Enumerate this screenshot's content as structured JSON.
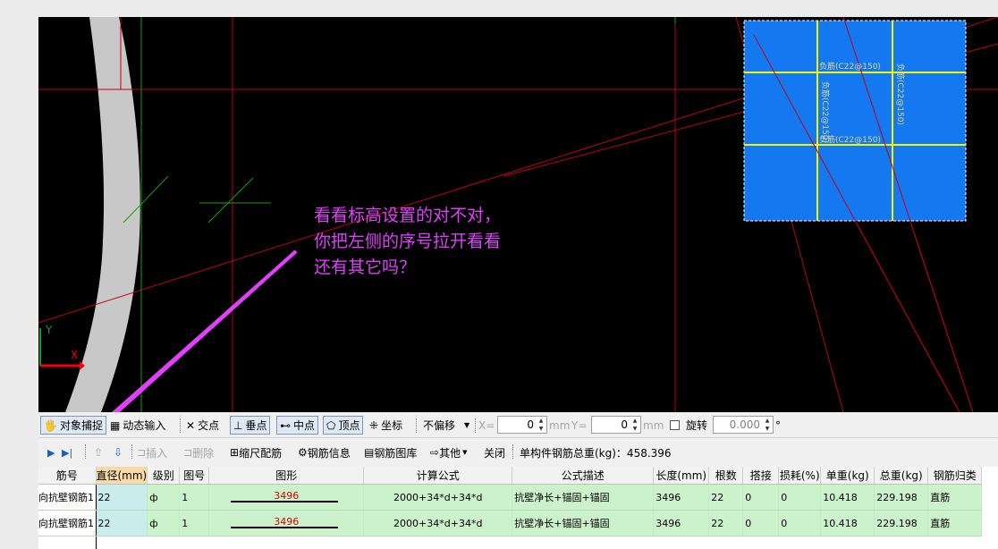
{
  "annotation": {
    "lines": [
      "看看标高设置的对不对，",
      "你把左侧的序号拉开看看",
      "还有其它吗？"
    ]
  },
  "canvas": {
    "box_labels": [
      "负筋(C22@150)",
      "负筋(C22@150)",
      "负筋(C22@150)",
      "负筋(C22@150)"
    ],
    "axis_y": "Y",
    "axis_x": "X"
  },
  "toolbar1": {
    "snap": "对象捕捉",
    "dynamic_input": "动态输入",
    "intersection": "交点",
    "perpendicular": "垂点",
    "midpoint": "中点",
    "vertex": "顶点",
    "coordinate": "坐标",
    "offset_mode": "不偏移",
    "x_label": "X=",
    "x_value": "0",
    "x_unit": "mm",
    "y_label": "Y=",
    "y_value": "0",
    "y_unit": "mm",
    "rotate": "旋转",
    "rotate_value": "0.000",
    "degree": "°"
  },
  "toolbar2": {
    "insert": "插入",
    "delete": "删除",
    "scale_rebar": "缩尺配筋",
    "rebar_info": "钢筋信息",
    "rebar_library": "钢筋图库",
    "other": "其他",
    "close": "关闭",
    "total_weight": "单构件钢筋总重(kg)：458.396"
  },
  "table": {
    "headers": [
      "筋号",
      "直径(mm)",
      "级别",
      "图号",
      "图形",
      "计算公式",
      "公式描述",
      "长度(mm)",
      "根数",
      "搭接",
      "损耗(%)",
      "单重(kg)",
      "总重(kg)",
      "钢筋归类"
    ],
    "rows": [
      [
        "向抗壁钢筋1",
        "22",
        "ф",
        "1",
        "3496",
        "2000+34*d+34*d",
        "抗壁净长+锚固+锚固",
        "3496",
        "22",
        "0",
        "0",
        "10.418",
        "229.198",
        "直筋"
      ],
      [
        "向抗壁钢筋1",
        "22",
        "ф",
        "1",
        "3496",
        "2000+34*d+34*d",
        "抗壁净长+锚固+锚固",
        "3496",
        "22",
        "0",
        "0",
        "10.418",
        "229.198",
        "直筋"
      ]
    ]
  }
}
